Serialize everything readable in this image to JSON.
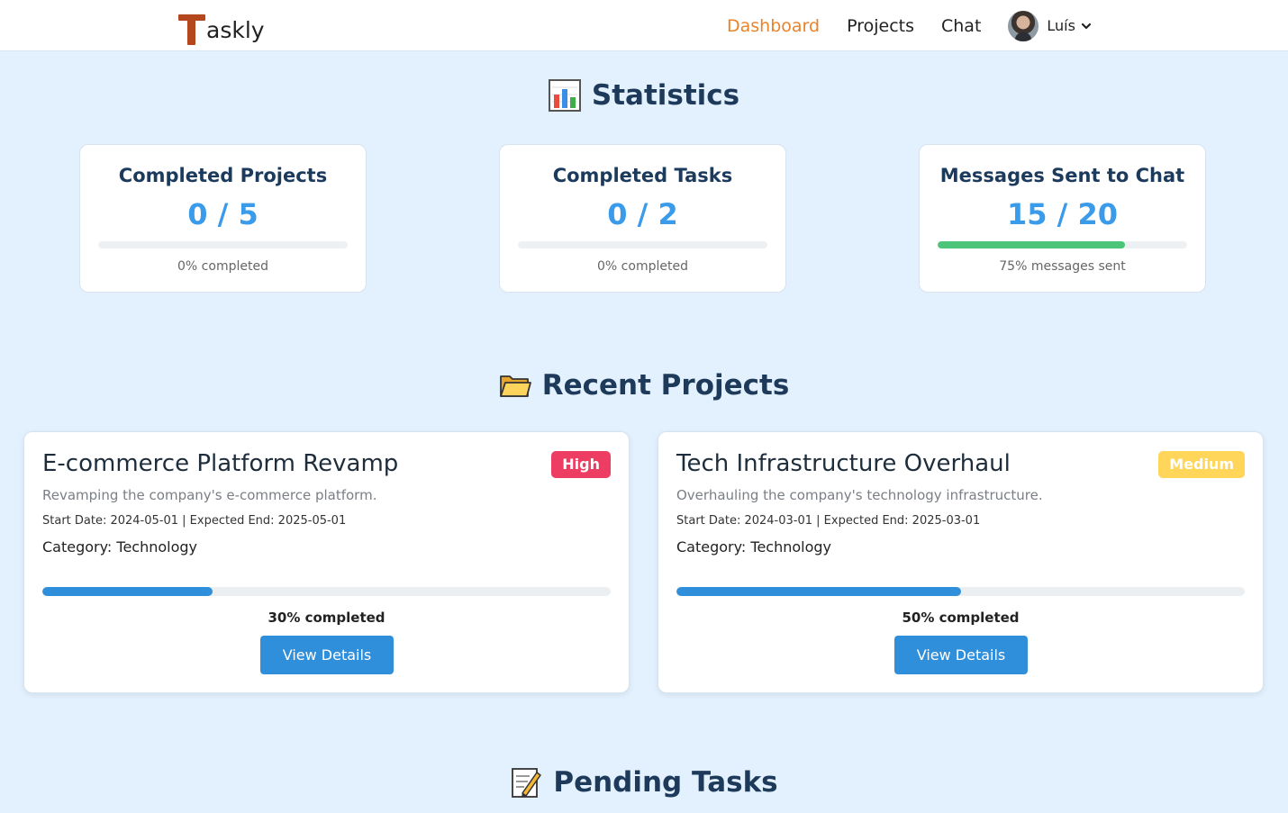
{
  "nav": {
    "brand_initial": "T",
    "brand_rest": "askly",
    "links": [
      "Dashboard",
      "Projects",
      "Chat"
    ],
    "active_index": 0,
    "user_name": "Luís"
  },
  "statistics": {
    "heading": "Statistics",
    "heading_icon": "bar-chart-emoji",
    "cards": [
      {
        "title": "Completed Projects",
        "value": "0 / 5",
        "progress": 0,
        "note": "0% completed"
      },
      {
        "title": "Completed Tasks",
        "value": "0 / 2",
        "progress": 0,
        "note": "0% completed"
      },
      {
        "title": "Messages Sent to Chat",
        "value": "15 / 20",
        "progress": 75,
        "note": "75% messages sent"
      }
    ]
  },
  "projects": {
    "heading": "Recent Projects",
    "heading_icon": "folder-emoji",
    "items": [
      {
        "title": "E-commerce Platform Revamp",
        "priority": "High",
        "description": "Revamping the company's e-commerce platform.",
        "dates": "Start Date: 2024-05-01 | Expected End: 2025-05-01",
        "category": "Category: Technology",
        "progress": 30,
        "progress_label": "30% completed",
        "button": "View Details"
      },
      {
        "title": "Tech Infrastructure Overhaul",
        "priority": "Medium",
        "description": "Overhauling the company's technology infrastructure.",
        "dates": "Start Date: 2024-03-01 | Expected End: 2025-03-01",
        "category": "Category: Technology",
        "progress": 50,
        "progress_label": "50% completed",
        "button": "View Details"
      }
    ]
  },
  "tasks": {
    "heading": "Pending Tasks",
    "heading_icon": "memo-emoji"
  },
  "colors": {
    "accent": "#e9832b",
    "primary": "#2f8fdb",
    "stat_value": "#3a9bea",
    "success": "#4cc57a",
    "high": "#ee3d63",
    "medium": "#ffd65a",
    "background": "#e3f0fd"
  }
}
